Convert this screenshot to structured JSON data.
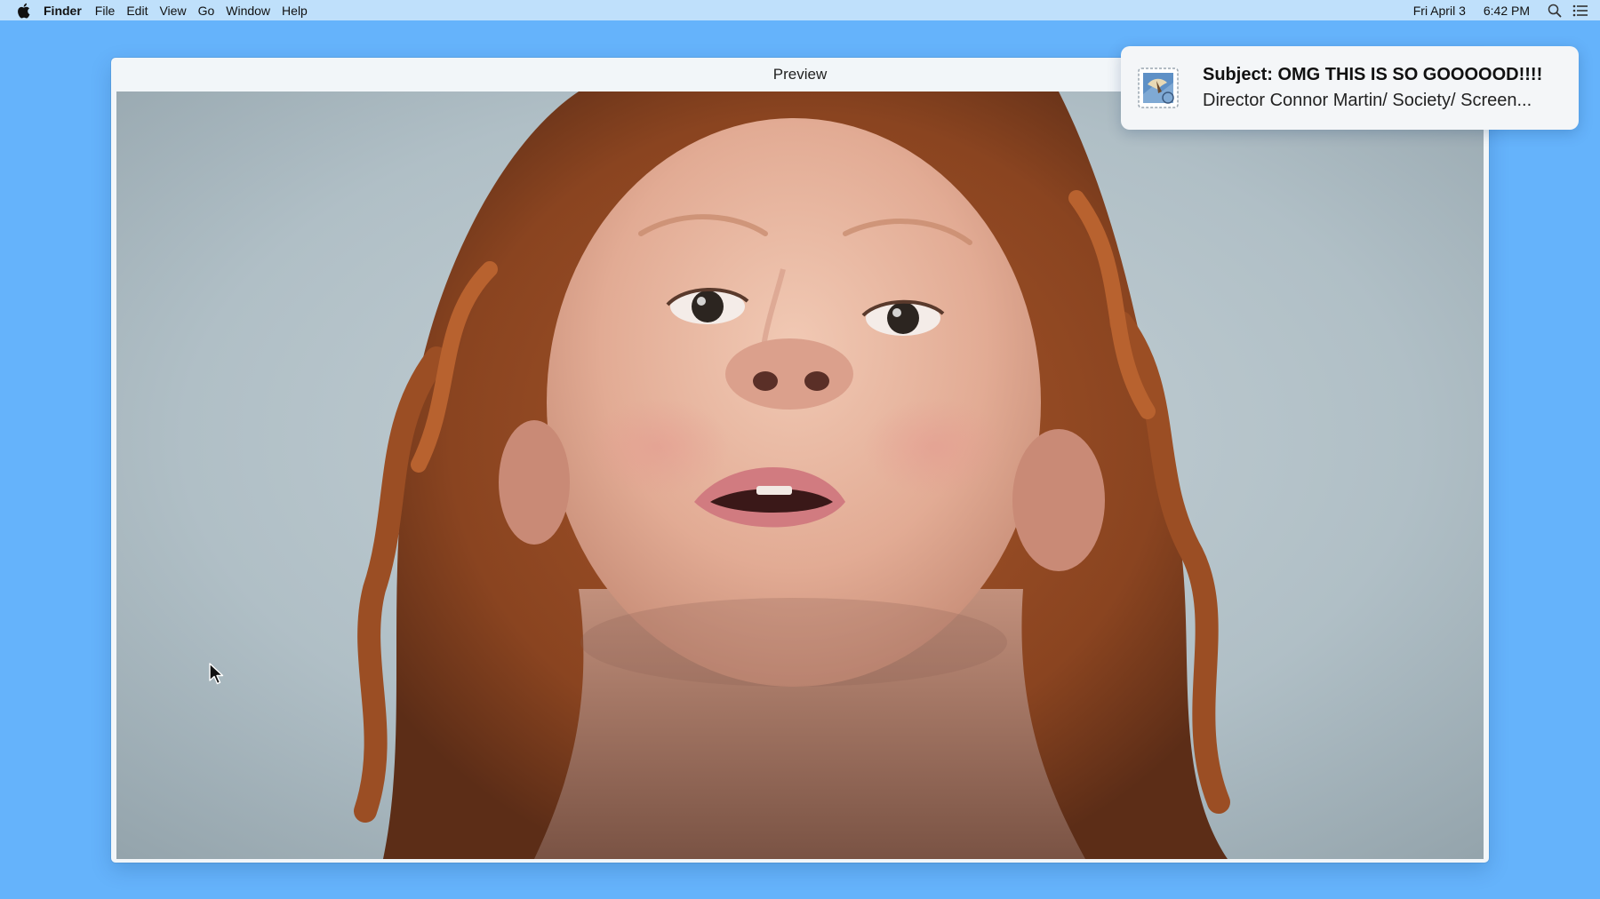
{
  "menubar": {
    "apple_icon": "apple-icon",
    "app_name": "Finder",
    "items": [
      "File",
      "Edit",
      "View",
      "Go",
      "Window",
      "Help"
    ],
    "date": "Fri April 3",
    "time": "6:42 PM",
    "tray_icons": [
      "spotlight-search-icon",
      "notification-center-icon"
    ]
  },
  "window": {
    "title": "Preview",
    "content": "photo-close-up-child-with-red-curly-hair"
  },
  "notification": {
    "app_icon": "mail-stamp-icon",
    "subject": "Subject: OMG THIS IS SO GOOOOOD!!!!",
    "body": "Director Connor Martin/ Society/ Screen..."
  },
  "colors": {
    "desktop": "#65b3fb",
    "menubar": "#bfe0fb",
    "window_bg": "#f2f6f9",
    "notification_bg": "#f4f6f8"
  }
}
